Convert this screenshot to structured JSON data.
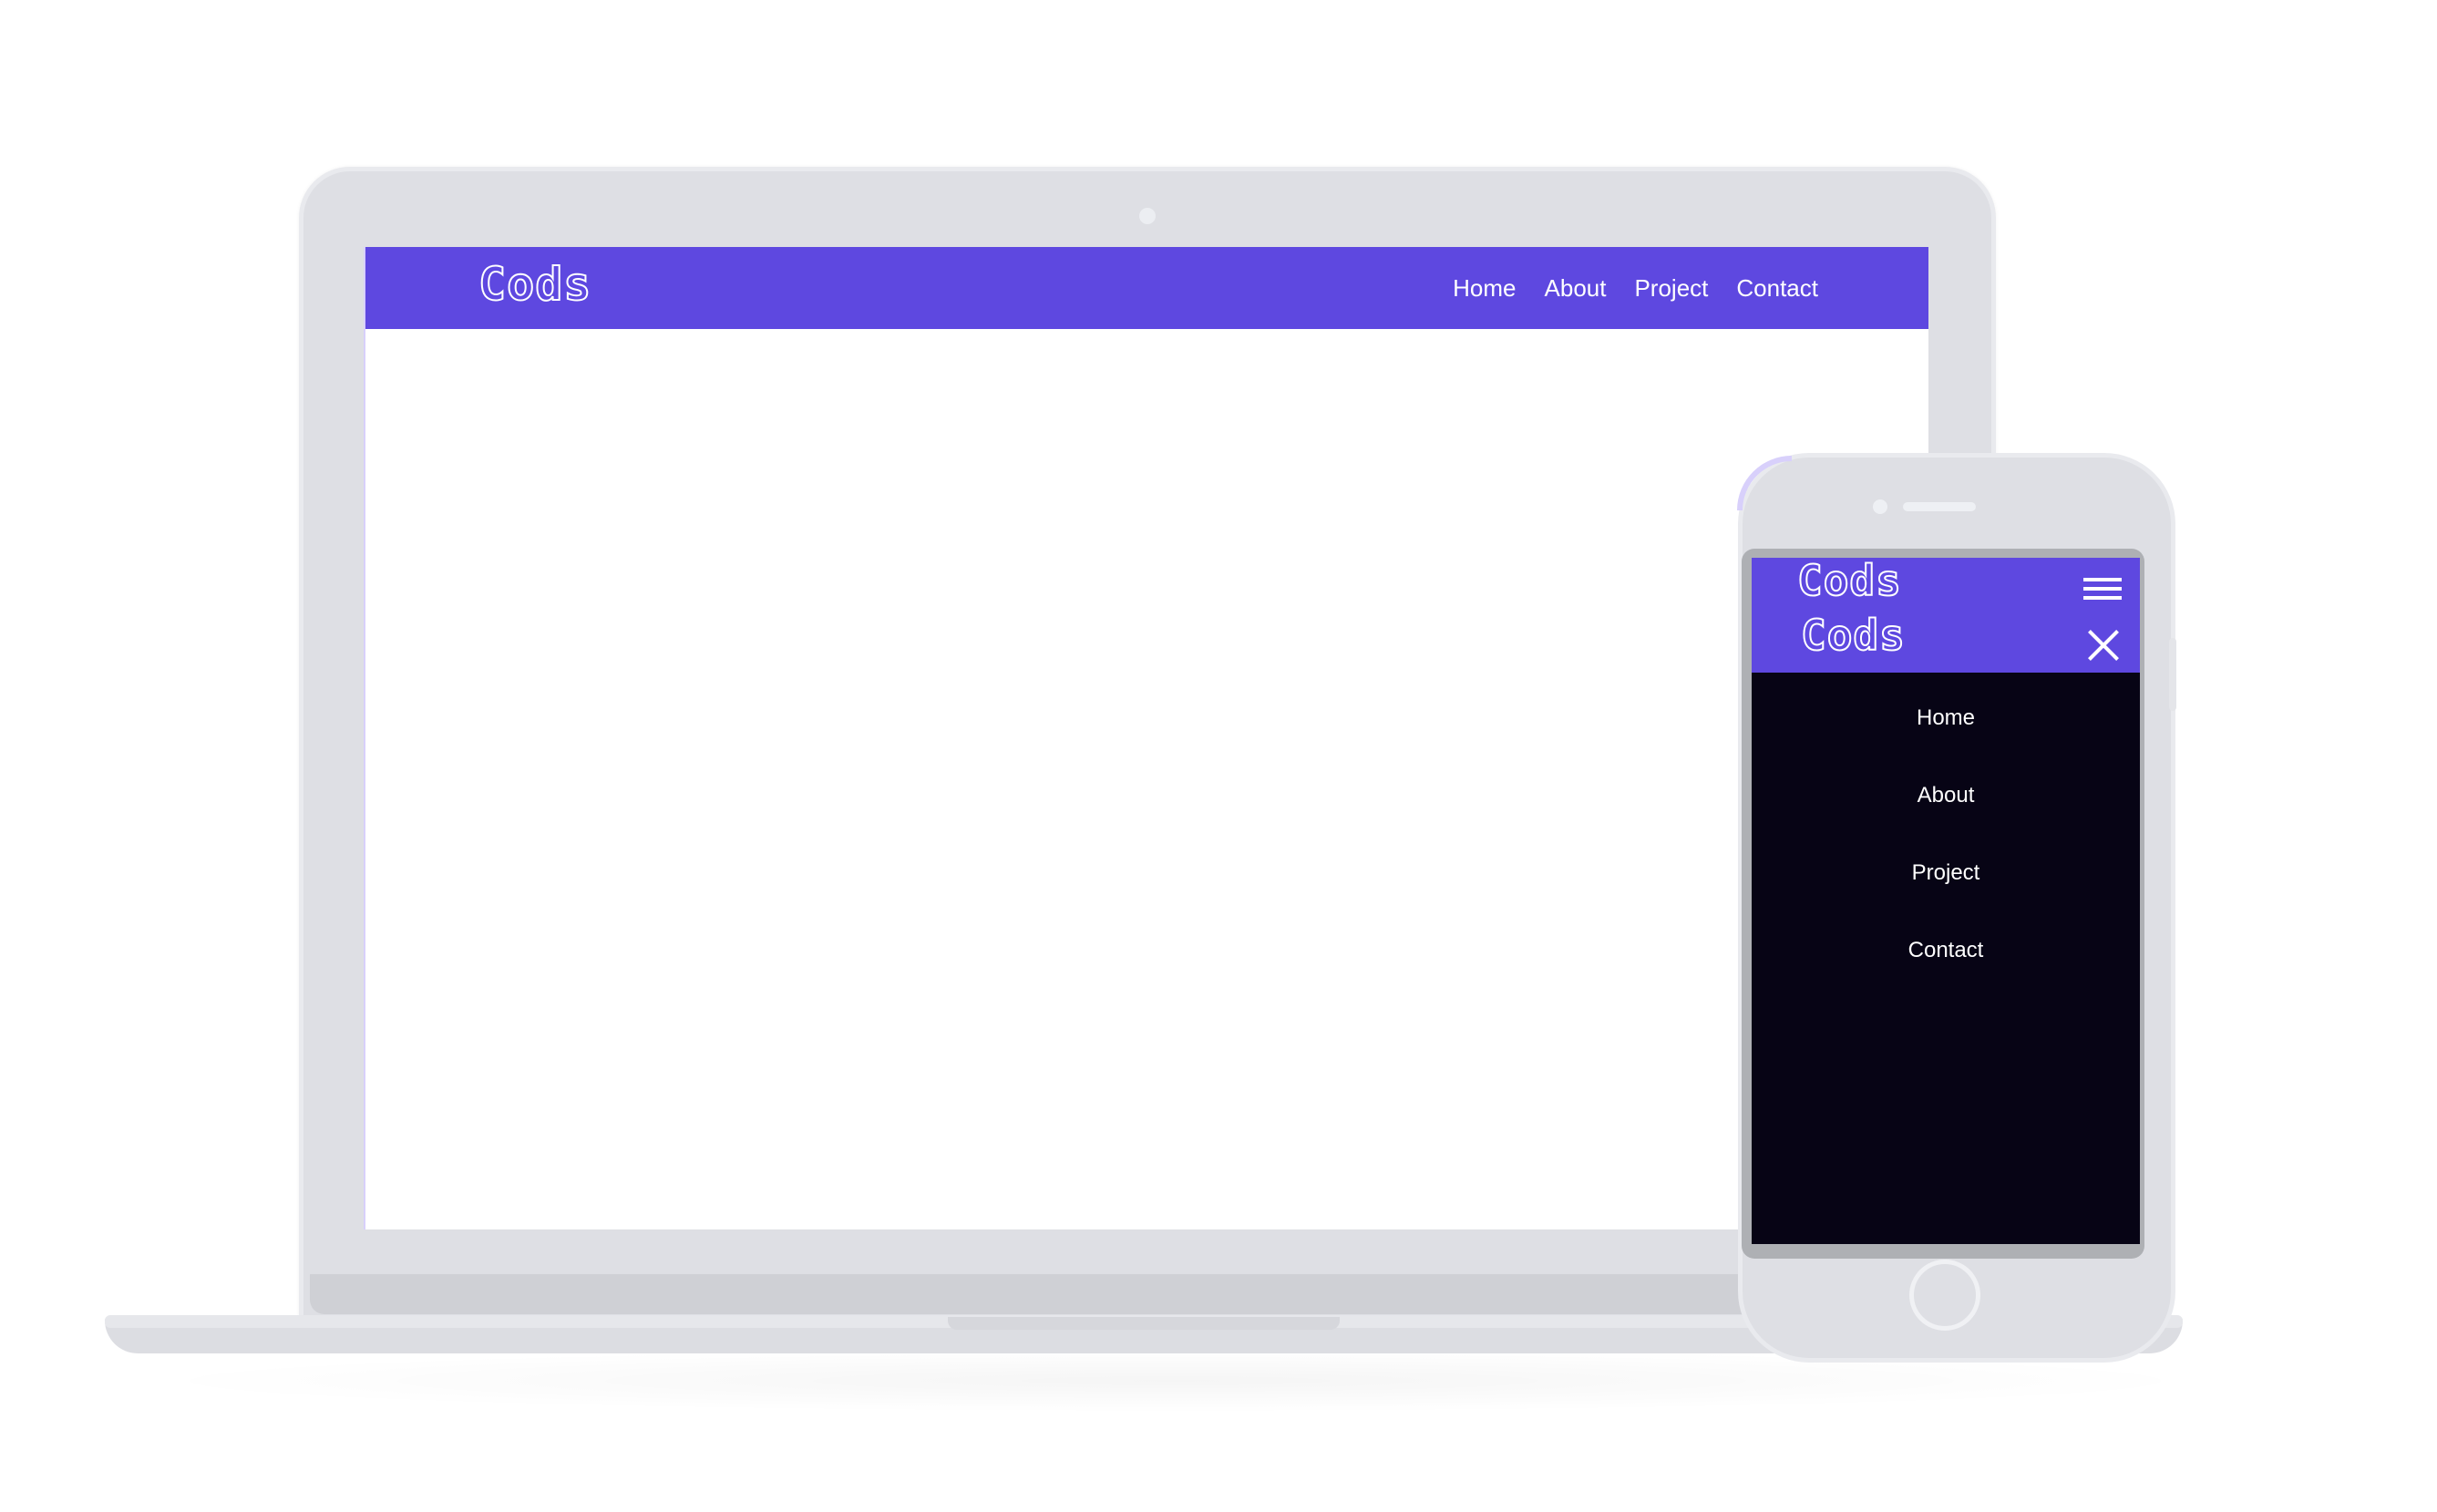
{
  "colors": {
    "brand": "#5e48e0",
    "menu_background": "#070415",
    "device_frame": "#dedfe4",
    "text_light": "#ffffff"
  },
  "desktop": {
    "logo": "Cods",
    "nav_links": [
      {
        "label": "Home"
      },
      {
        "label": "About"
      },
      {
        "label": "Project"
      },
      {
        "label": "Contact"
      }
    ]
  },
  "mobile": {
    "logo_primary": "Cods",
    "logo_secondary": "Cods",
    "menu_icon": "hamburger-icon",
    "close_icon": "close-icon",
    "menu_links": [
      {
        "label": "Home"
      },
      {
        "label": "About"
      },
      {
        "label": "Project"
      },
      {
        "label": "Contact"
      }
    ]
  }
}
